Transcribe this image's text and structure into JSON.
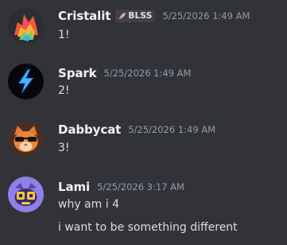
{
  "messages": [
    {
      "username": "Cristalit",
      "tag": "BLSS",
      "timestamp": "5/25/2026 1:49 AM",
      "lines": [
        "1!"
      ],
      "avatar_icon": "flame-gem-avatar-icon",
      "name_color": "#f2f3f5"
    },
    {
      "username": "Spark",
      "timestamp": "5/25/2026 1:49 AM",
      "lines": [
        "2!"
      ],
      "avatar_icon": "lightning-bolt-avatar-icon",
      "name_color": "#f2f3f5"
    },
    {
      "username": "Dabbycat",
      "timestamp": "5/25/2026 1:49 AM",
      "lines": [
        "3!"
      ],
      "avatar_icon": "cat-sunglasses-avatar-icon",
      "name_color": "#f2f3f5"
    },
    {
      "username": "Lami",
      "timestamp": "5/25/2026 3:17 AM",
      "lines": [
        "why am i 4",
        "i want to be something different"
      ],
      "avatar_icon": "purple-bug-avatar-icon",
      "name_color": "#f2f3f5"
    }
  ],
  "colors": {
    "background": "#323339",
    "text": "#dbdee1",
    "timestamp": "#949ba4",
    "tag_bg": "#3f4147",
    "tag_icon": "#f7a8d8"
  }
}
